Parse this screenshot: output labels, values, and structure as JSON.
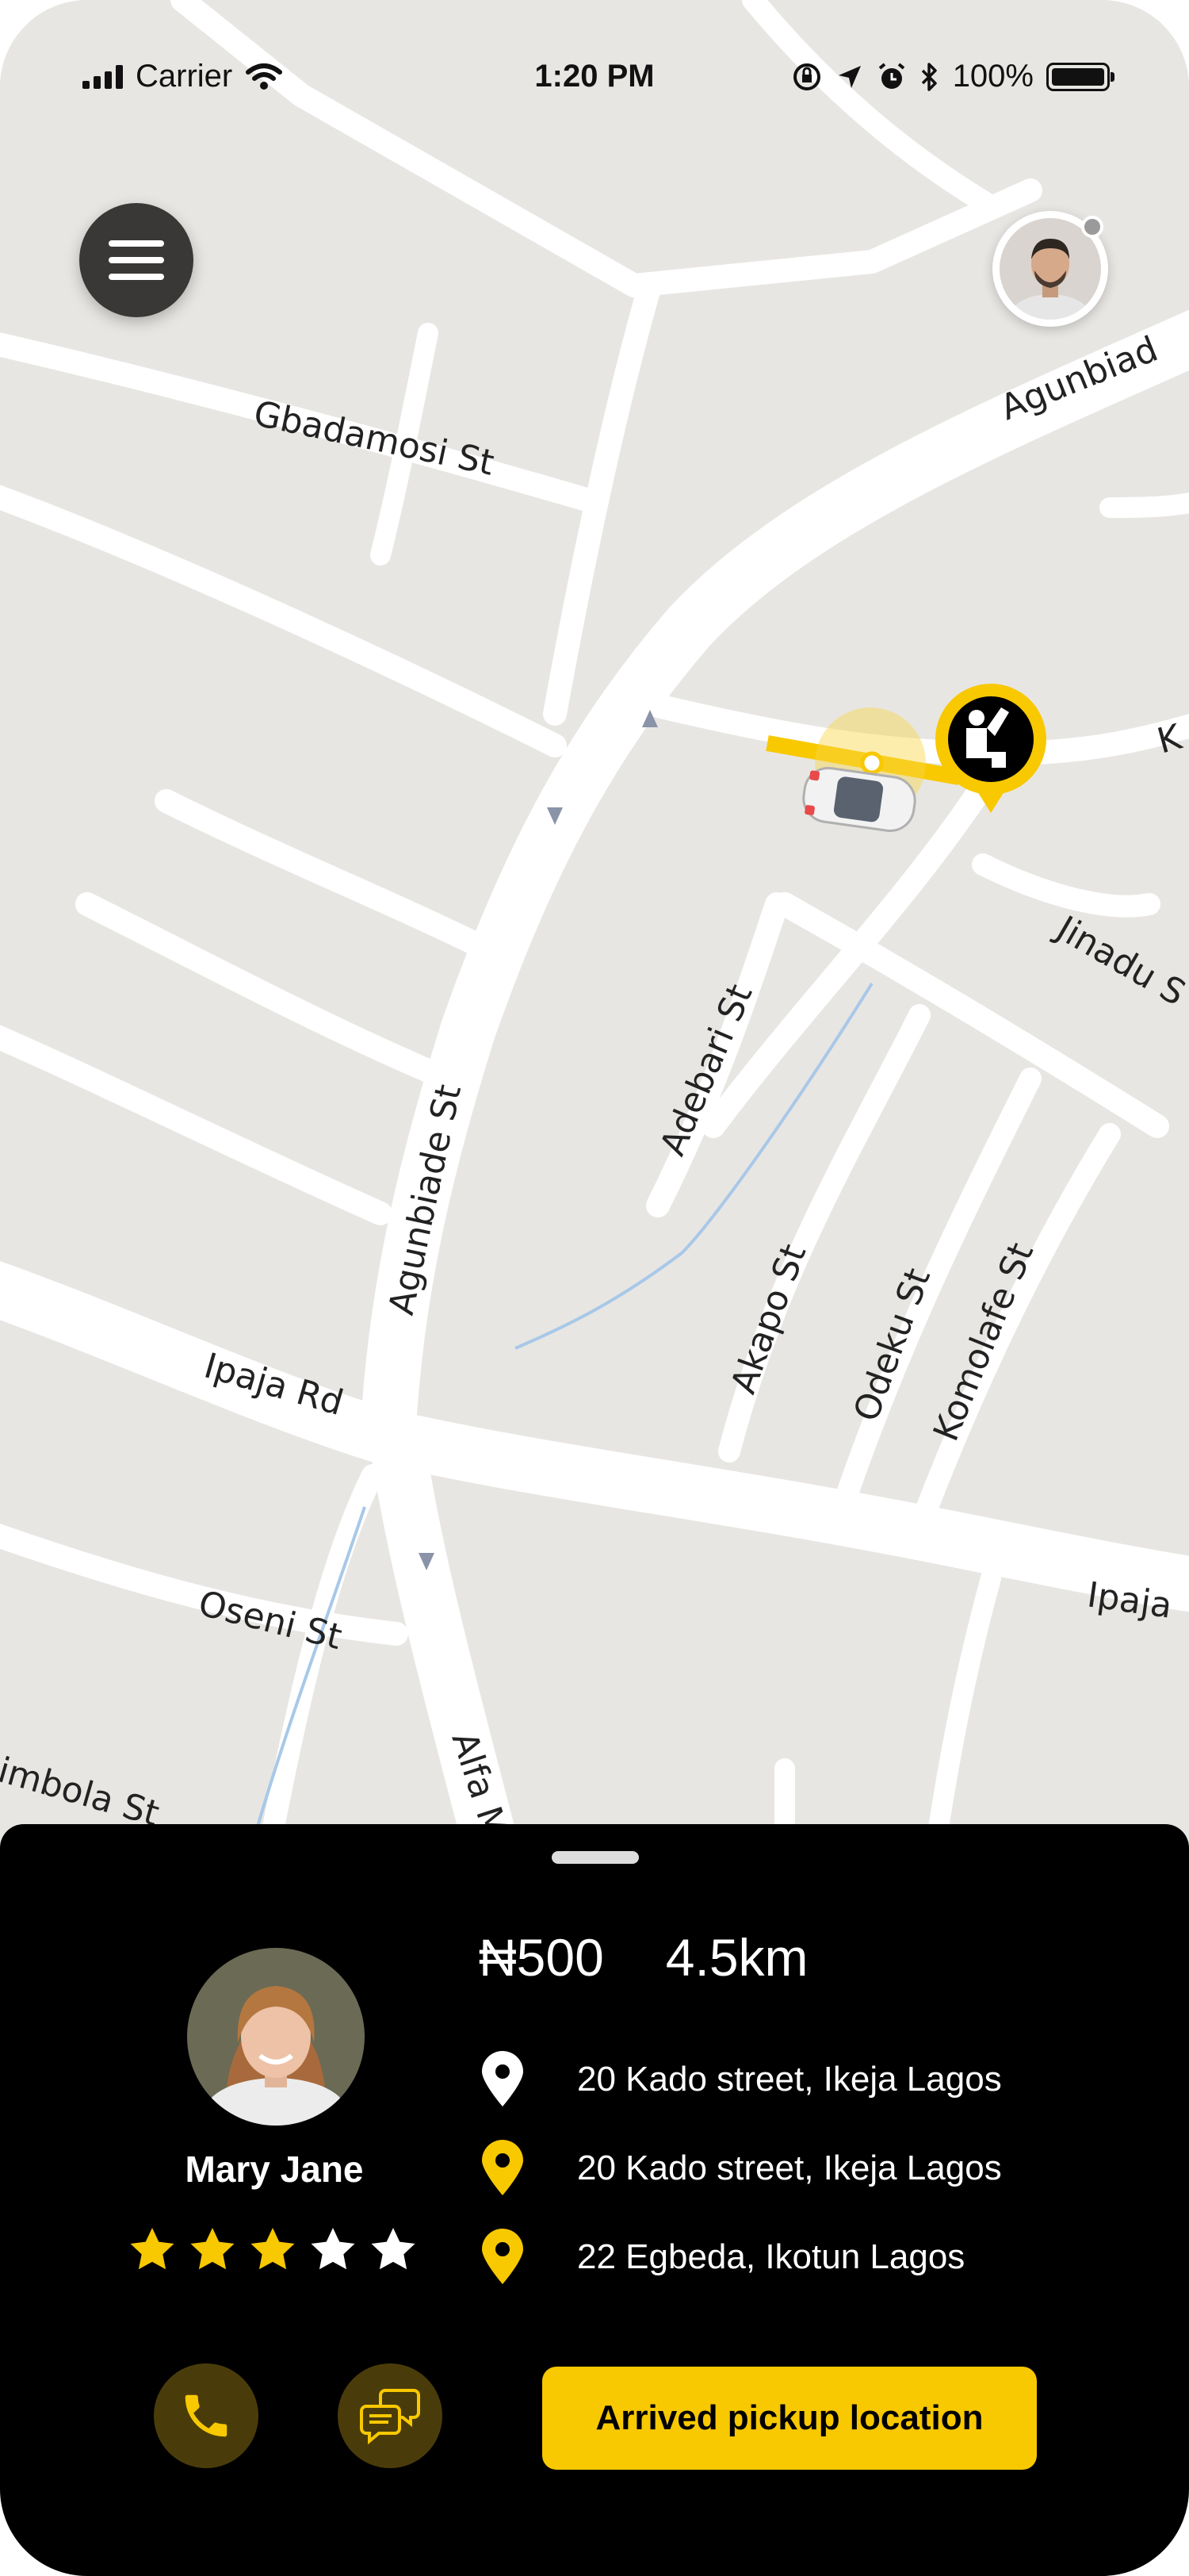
{
  "status_bar": {
    "carrier": "Carrier",
    "time": "1:20 PM",
    "battery": "100%",
    "battery_level": 1.0
  },
  "map": {
    "street_labels": [
      "Agunbiad",
      "Gbadamosi St",
      "K",
      "Jinadu S",
      "Adebari St",
      "Agunbiade St",
      "Akapo St",
      "Odeku St",
      "Komolafe St",
      "Ipaja Rd",
      "Ipaja",
      "Oseni St",
      "Alfa M",
      "imbola St"
    ],
    "rider_pin_icon": "waving-person-icon",
    "car_icon": "car-icon"
  },
  "header": {
    "menu_icon": "hamburger-menu-icon",
    "profile_status_color": "#9a9a9a"
  },
  "trip_sheet": {
    "driver_name": "Mary Jane",
    "rating": 3,
    "rating_max": 5,
    "fare": "₦500",
    "distance": "4.5km",
    "addresses": [
      {
        "text": "20 Kado street, Ikeja Lagos",
        "pin_color": "#ffffff"
      },
      {
        "text": "20 Kado street, Ikeja Lagos",
        "pin_color": "#f8c800"
      },
      {
        "text": "22 Egbeda, Ikotun Lagos",
        "pin_color": "#f8c800"
      }
    ],
    "call_icon": "phone-icon",
    "chat_icon": "chat-bubbles-icon",
    "action_label": "Arrived pickup location"
  },
  "colors": {
    "accent": "#f8c800",
    "sheet_background": "#000000",
    "map_background": "#e8e6e3",
    "road": "#ffffff"
  }
}
